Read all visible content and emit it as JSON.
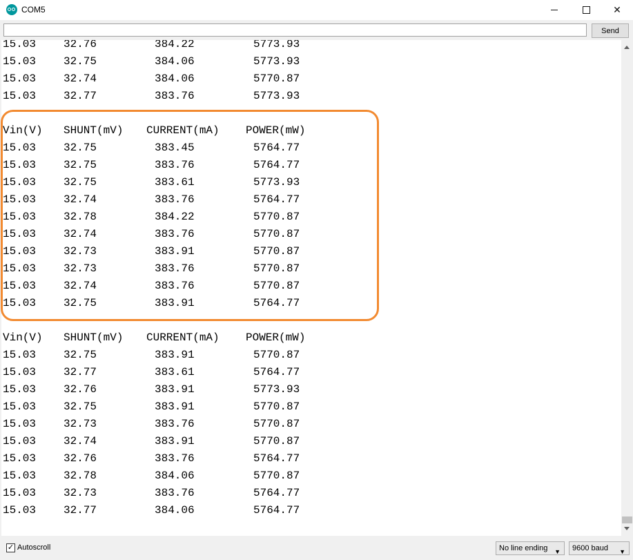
{
  "window": {
    "title": "COM5"
  },
  "toolbar": {
    "send_label": "Send",
    "input_value": ""
  },
  "serial": {
    "lines": [
      [
        "15.03",
        "32.76",
        "384.22",
        "5773.93"
      ],
      [
        "15.03",
        "32.75",
        "384.06",
        "5773.93"
      ],
      [
        "15.03",
        "32.74",
        "384.06",
        "5770.87"
      ],
      [
        "15.03",
        "32.77",
        "383.76",
        "5773.93"
      ],
      [],
      [
        "Vin(V)",
        "SHUNT(mV)",
        "CURRENT(mA)",
        "POWER(mW)"
      ],
      [
        "15.03",
        "32.75",
        "383.45",
        "5764.77"
      ],
      [
        "15.03",
        "32.75",
        "383.76",
        "5764.77"
      ],
      [
        "15.03",
        "32.75",
        "383.61",
        "5773.93"
      ],
      [
        "15.03",
        "32.74",
        "383.76",
        "5764.77"
      ],
      [
        "15.03",
        "32.78",
        "384.22",
        "5770.87"
      ],
      [
        "15.03",
        "32.74",
        "383.76",
        "5770.87"
      ],
      [
        "15.03",
        "32.73",
        "383.91",
        "5770.87"
      ],
      [
        "15.03",
        "32.73",
        "383.76",
        "5770.87"
      ],
      [
        "15.03",
        "32.74",
        "383.76",
        "5770.87"
      ],
      [
        "15.03",
        "32.75",
        "383.91",
        "5764.77"
      ],
      [],
      [
        "Vin(V)",
        "SHUNT(mV)",
        "CURRENT(mA)",
        "POWER(mW)"
      ],
      [
        "15.03",
        "32.75",
        "383.91",
        "5770.87"
      ],
      [
        "15.03",
        "32.77",
        "383.61",
        "5764.77"
      ],
      [
        "15.03",
        "32.76",
        "383.91",
        "5773.93"
      ],
      [
        "15.03",
        "32.75",
        "383.91",
        "5770.87"
      ],
      [
        "15.03",
        "32.73",
        "383.76",
        "5770.87"
      ],
      [
        "15.03",
        "32.74",
        "383.91",
        "5770.87"
      ],
      [
        "15.03",
        "32.76",
        "383.76",
        "5764.77"
      ],
      [
        "15.03",
        "32.78",
        "384.06",
        "5770.87"
      ],
      [
        "15.03",
        "32.73",
        "383.76",
        "5764.77"
      ],
      [
        "15.03",
        "32.77",
        "384.06",
        "5764.77"
      ]
    ]
  },
  "footer": {
    "autoscroll_label": "Autoscroll",
    "autoscroll_checked": true,
    "line_ending": "No line ending",
    "baud": "9600 baud"
  },
  "colors": {
    "highlight": "#f28a30",
    "app_icon": "#00979d"
  }
}
